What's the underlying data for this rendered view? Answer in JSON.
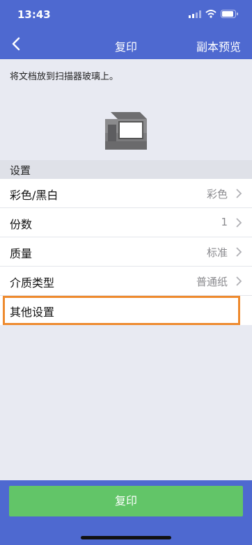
{
  "status_bar": {
    "time": "13:43"
  },
  "nav": {
    "title": "复印",
    "preview_label": "副本预览"
  },
  "instruction": "将文档放到扫描器玻璃上。",
  "settings": {
    "section_title": "设置",
    "rows": [
      {
        "label": "彩色/黑白",
        "value": "彩色"
      },
      {
        "label": "份数",
        "value": "1"
      },
      {
        "label": "质量",
        "value": "标准"
      },
      {
        "label": "介质类型",
        "value": "普通纸"
      },
      {
        "label": "其他设置",
        "value": ""
      }
    ]
  },
  "action": {
    "copy_label": "复印"
  },
  "colors": {
    "header": "#4e69d0",
    "button": "#62c568",
    "highlight": "#ee8a2e"
  }
}
